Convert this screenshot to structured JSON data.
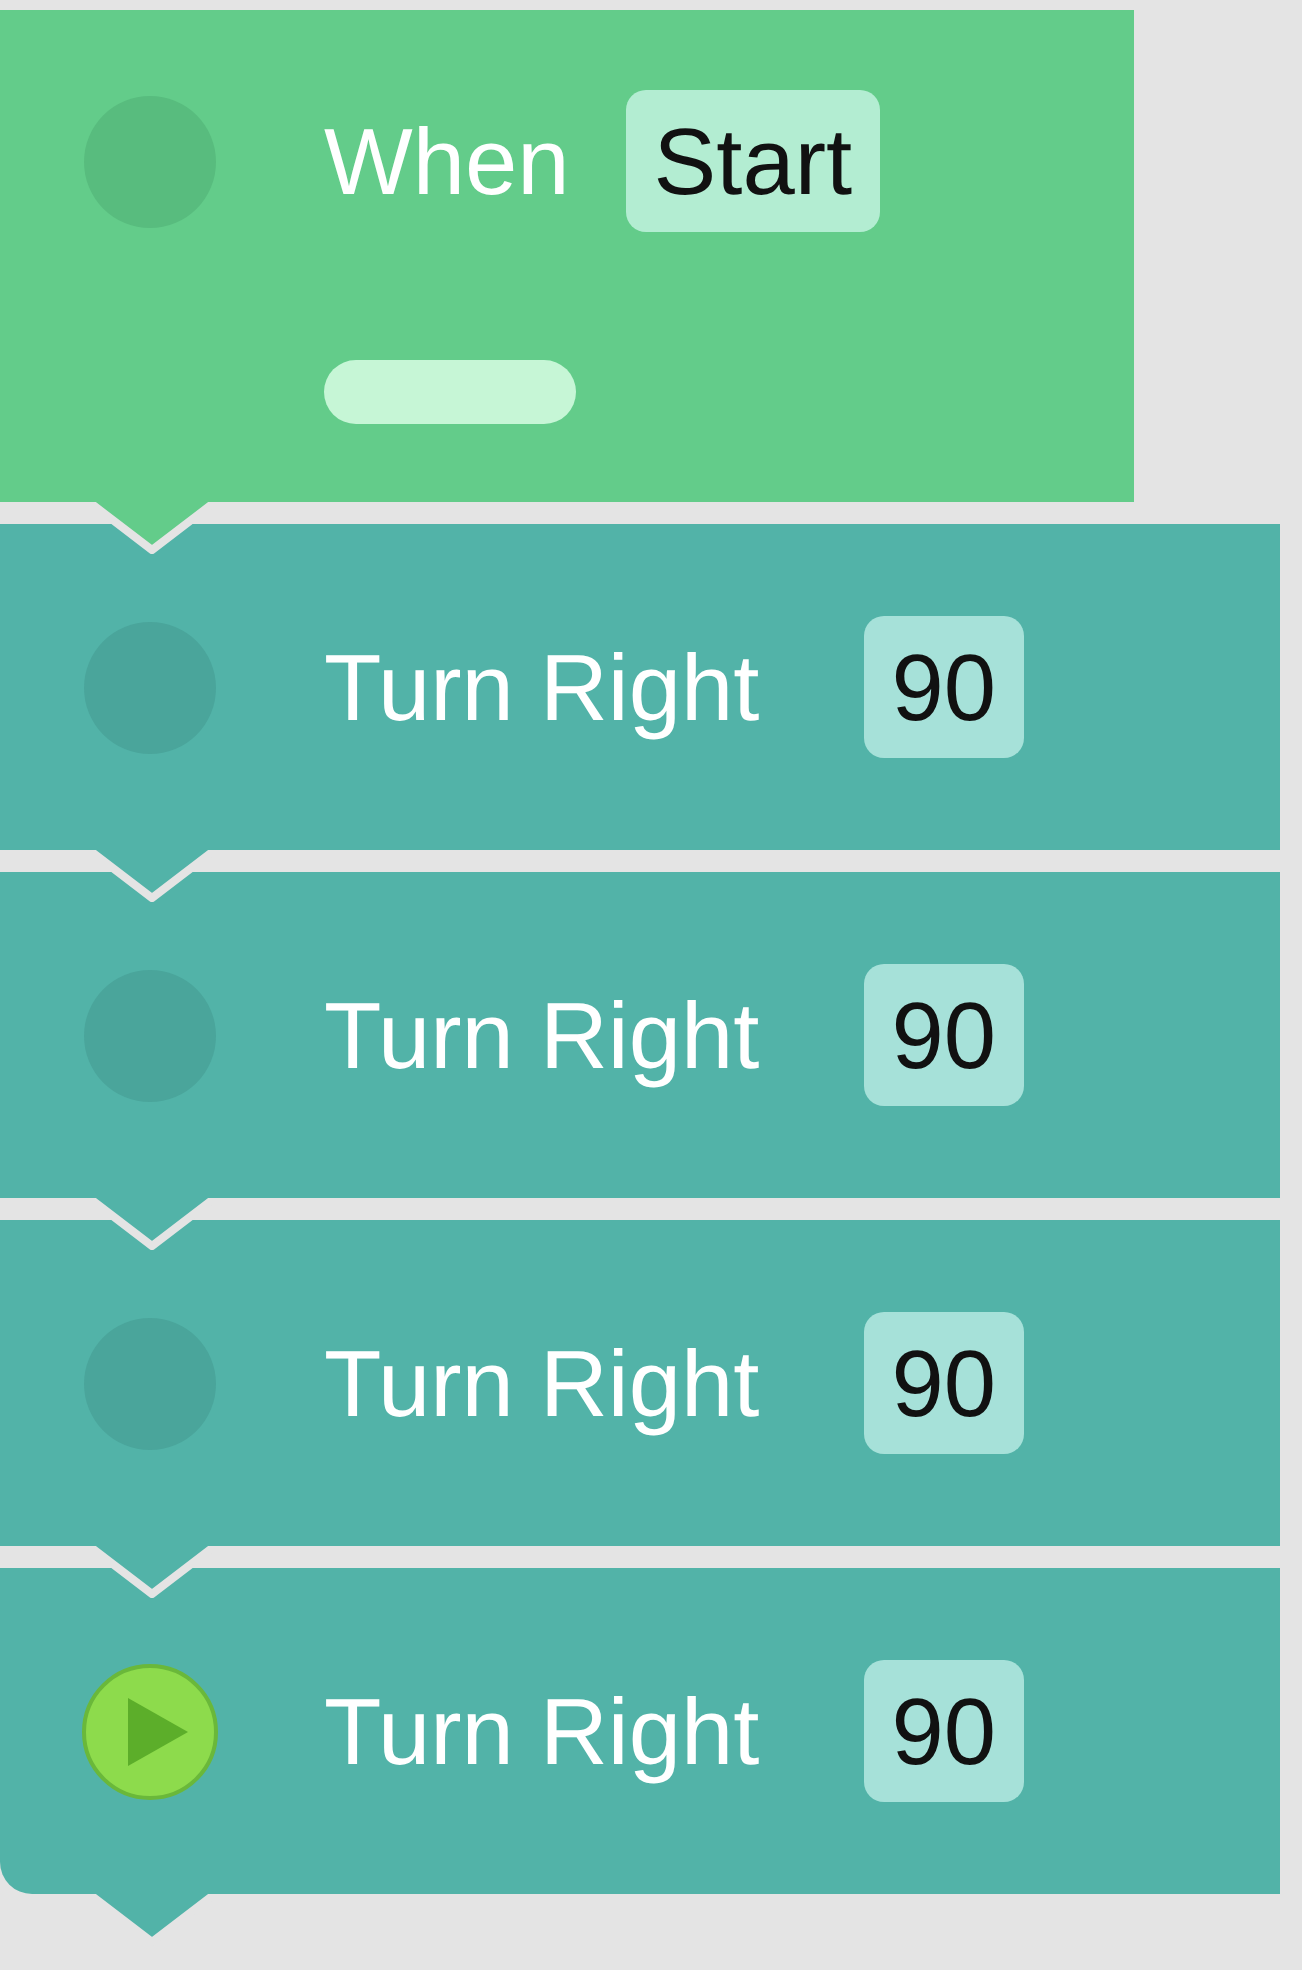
{
  "hat_block": {
    "label": "When",
    "trigger": "Start"
  },
  "blocks": [
    {
      "label": "Turn Right",
      "value": "90",
      "running": false
    },
    {
      "label": "Turn Right",
      "value": "90",
      "running": false
    },
    {
      "label": "Turn Right",
      "value": "90",
      "running": false
    },
    {
      "label": "Turn Right",
      "value": "90",
      "running": true
    }
  ]
}
